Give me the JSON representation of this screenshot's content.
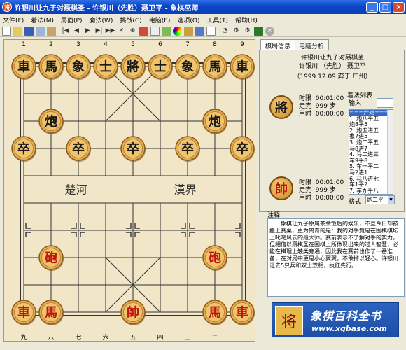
{
  "window": {
    "title": "许银川让九子对聂棋圣 - 许银川（先胜）聂卫平 - 象棋巫师",
    "app_icon": "将"
  },
  "menu": [
    "文件(F)",
    "着法(M)",
    "局面(P)",
    "魔法(W)",
    "挑战(C)",
    "电脑(E)",
    "选项(O)",
    "工具(T)",
    "帮助(H)"
  ],
  "toolbar_icons": [
    "new-icon",
    "open-icon",
    "save-icon",
    "copy-icon",
    "paste-icon",
    "first-move-icon",
    "prev-icon",
    "play-icon",
    "next-icon",
    "last-move-icon",
    "cut-icon",
    "search-icon",
    "board-icon",
    "doc-icon",
    "grid-icon",
    "color-icon",
    "lock-icon",
    "flip-icon",
    "book-icon",
    "clock-icon",
    "engine-icon",
    "hint-icon",
    "monitor-icon",
    "stop-icon"
  ],
  "board": {
    "top_files": [
      "1",
      "2",
      "3",
      "4",
      "5",
      "6",
      "7",
      "8",
      "9"
    ],
    "bottom_files": [
      "九",
      "八",
      "七",
      "六",
      "五",
      "四",
      "三",
      "二",
      "一"
    ],
    "river_left": "楚河",
    "river_right": "漢界",
    "black_pieces": [
      {
        "char": "車",
        "f": 0,
        "r": 0
      },
      {
        "char": "馬",
        "f": 1,
        "r": 0
      },
      {
        "char": "象",
        "f": 2,
        "r": 0
      },
      {
        "char": "士",
        "f": 3,
        "r": 0
      },
      {
        "char": "將",
        "f": 4,
        "r": 0
      },
      {
        "char": "士",
        "f": 5,
        "r": 0
      },
      {
        "char": "象",
        "f": 6,
        "r": 0
      },
      {
        "char": "馬",
        "f": 7,
        "r": 0
      },
      {
        "char": "車",
        "f": 8,
        "r": 0
      },
      {
        "char": "炮",
        "f": 1,
        "r": 2
      },
      {
        "char": "炮",
        "f": 7,
        "r": 2
      },
      {
        "char": "卒",
        "f": 0,
        "r": 3
      },
      {
        "char": "卒",
        "f": 2,
        "r": 3
      },
      {
        "char": "卒",
        "f": 4,
        "r": 3
      },
      {
        "char": "卒",
        "f": 6,
        "r": 3
      },
      {
        "char": "卒",
        "f": 8,
        "r": 3
      }
    ],
    "red_pieces": [
      {
        "char": "砲",
        "f": 1,
        "r": 7
      },
      {
        "char": "砲",
        "f": 7,
        "r": 7
      },
      {
        "char": "車",
        "f": 0,
        "r": 9
      },
      {
        "char": "馬",
        "f": 1,
        "r": 9
      },
      {
        "char": "帥",
        "f": 4,
        "r": 9
      },
      {
        "char": "馬",
        "f": 7,
        "r": 9
      },
      {
        "char": "車",
        "f": 8,
        "r": 9
      }
    ]
  },
  "tabs": {
    "game_info": "棋局信息",
    "engine_analysis": "电脑分析"
  },
  "game": {
    "event": "许银川让九子对聂棋圣",
    "players": "许银川 （先胜） 聂卫平",
    "date_place": "（1999.12.09 弈于 广州）"
  },
  "black_player": {
    "piece": "將",
    "time_label": "时限",
    "time_value": "00:01:00",
    "moves_label": "走完",
    "moves_value": "999 步",
    "used_label": "用时",
    "used_value": "00:00:00"
  },
  "red_player": {
    "piece": "帥",
    "time_label": "时限",
    "time_value": "00:01:00",
    "moves_label": "走完",
    "moves_value": "999 步",
    "used_label": "用时",
    "used_value": "00:00:00"
  },
  "moves": {
    "list_label": "着法列表",
    "input_label": "输入",
    "items": [
      "===开始===",
      "1. 炮八平五",
      "   炮8平5",
      "2. 炮五进五",
      "   象7进5",
      "3. 炮二平五",
      "   马8进7",
      "4. 马二进三",
      "   车9平8",
      "5. 车一平二",
      "   马2进1",
      "6. 马八进七",
      "   车1平2",
      "7. 车九平八",
      "8. 车六进八"
    ],
    "format_label": "格式",
    "format_value": "炮二平"
  },
  "note": {
    "label": "注释",
    "text": "象棋让九子原属茶余饭后的娱乐，不登今日却被搬上赛桌，更为离奇的是：我的对手竟是在围棋棋坛上叱咤风云的聂大师。赛前表示不了解对手的实力，但相信以聂棋圣在围棋上所体现出来的过人智慧，必能在棋理上触类旁通，因此我在赛前也作了一番准备，在对局中更是小心翼翼，不敢掉以轻心。许银川让去5只兵和双士双相，执红先行。"
  },
  "banner": {
    "title": "象棋百科全书",
    "url": "www.xqbase.com",
    "icon": "将"
  }
}
